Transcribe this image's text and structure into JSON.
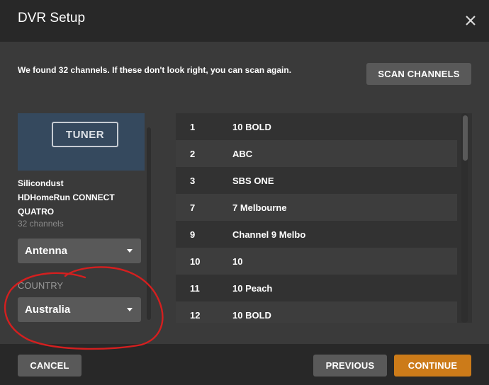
{
  "dialog": {
    "title": "DVR Setup",
    "close_icon": "close-icon"
  },
  "info": {
    "message": "We found 32 channels. If these don't look right, you can scan again.",
    "scan_button": "SCAN CHANNELS"
  },
  "device": {
    "image_label": "TUNER",
    "name_line1": "Silicondust",
    "name_line2": "HDHomeRun CONNECT",
    "name_line3": "QUATRO",
    "channel_count": "32 channels",
    "source_select": "Antenna",
    "country_label": "COUNTRY",
    "country_select": "Australia"
  },
  "channels": [
    {
      "number": "1",
      "name": "10 BOLD"
    },
    {
      "number": "2",
      "name": "ABC"
    },
    {
      "number": "3",
      "name": "SBS ONE"
    },
    {
      "number": "7",
      "name": "7 Melbourne"
    },
    {
      "number": "9",
      "name": "Channel 9 Melbo"
    },
    {
      "number": "10",
      "name": "10"
    },
    {
      "number": "11",
      "name": "10 Peach"
    },
    {
      "number": "12",
      "name": "10 BOLD"
    }
  ],
  "footer": {
    "cancel": "CANCEL",
    "previous": "PREVIOUS",
    "continue": "CONTINUE"
  },
  "colors": {
    "accent": "#cc7b19",
    "annotation": "#d41f1f"
  }
}
